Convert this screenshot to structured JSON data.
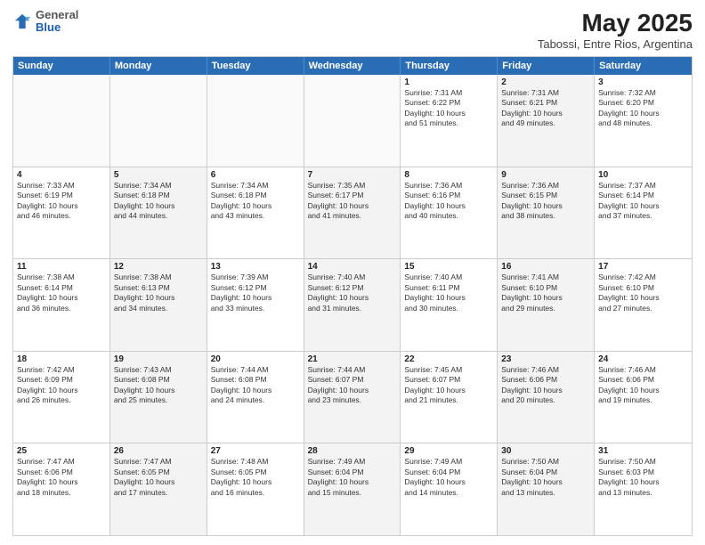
{
  "logo": {
    "general": "General",
    "blue": "Blue"
  },
  "title": "May 2025",
  "subtitle": "Tabossi, Entre Rios, Argentina",
  "weekdays": [
    "Sunday",
    "Monday",
    "Tuesday",
    "Wednesday",
    "Thursday",
    "Friday",
    "Saturday"
  ],
  "rows": [
    [
      {
        "day": "",
        "info": "",
        "empty": true
      },
      {
        "day": "",
        "info": "",
        "empty": true
      },
      {
        "day": "",
        "info": "",
        "empty": true
      },
      {
        "day": "",
        "info": "",
        "empty": true
      },
      {
        "day": "1",
        "info": "Sunrise: 7:31 AM\nSunset: 6:22 PM\nDaylight: 10 hours\nand 51 minutes."
      },
      {
        "day": "2",
        "info": "Sunrise: 7:31 AM\nSunset: 6:21 PM\nDaylight: 10 hours\nand 49 minutes.",
        "alt": true
      },
      {
        "day": "3",
        "info": "Sunrise: 7:32 AM\nSunset: 6:20 PM\nDaylight: 10 hours\nand 48 minutes."
      }
    ],
    [
      {
        "day": "4",
        "info": "Sunrise: 7:33 AM\nSunset: 6:19 PM\nDaylight: 10 hours\nand 46 minutes."
      },
      {
        "day": "5",
        "info": "Sunrise: 7:34 AM\nSunset: 6:18 PM\nDaylight: 10 hours\nand 44 minutes.",
        "alt": true
      },
      {
        "day": "6",
        "info": "Sunrise: 7:34 AM\nSunset: 6:18 PM\nDaylight: 10 hours\nand 43 minutes."
      },
      {
        "day": "7",
        "info": "Sunrise: 7:35 AM\nSunset: 6:17 PM\nDaylight: 10 hours\nand 41 minutes.",
        "alt": true
      },
      {
        "day": "8",
        "info": "Sunrise: 7:36 AM\nSunset: 6:16 PM\nDaylight: 10 hours\nand 40 minutes."
      },
      {
        "day": "9",
        "info": "Sunrise: 7:36 AM\nSunset: 6:15 PM\nDaylight: 10 hours\nand 38 minutes.",
        "alt": true
      },
      {
        "day": "10",
        "info": "Sunrise: 7:37 AM\nSunset: 6:14 PM\nDaylight: 10 hours\nand 37 minutes."
      }
    ],
    [
      {
        "day": "11",
        "info": "Sunrise: 7:38 AM\nSunset: 6:14 PM\nDaylight: 10 hours\nand 36 minutes."
      },
      {
        "day": "12",
        "info": "Sunrise: 7:38 AM\nSunset: 6:13 PM\nDaylight: 10 hours\nand 34 minutes.",
        "alt": true
      },
      {
        "day": "13",
        "info": "Sunrise: 7:39 AM\nSunset: 6:12 PM\nDaylight: 10 hours\nand 33 minutes."
      },
      {
        "day": "14",
        "info": "Sunrise: 7:40 AM\nSunset: 6:12 PM\nDaylight: 10 hours\nand 31 minutes.",
        "alt": true
      },
      {
        "day": "15",
        "info": "Sunrise: 7:40 AM\nSunset: 6:11 PM\nDaylight: 10 hours\nand 30 minutes."
      },
      {
        "day": "16",
        "info": "Sunrise: 7:41 AM\nSunset: 6:10 PM\nDaylight: 10 hours\nand 29 minutes.",
        "alt": true
      },
      {
        "day": "17",
        "info": "Sunrise: 7:42 AM\nSunset: 6:10 PM\nDaylight: 10 hours\nand 27 minutes."
      }
    ],
    [
      {
        "day": "18",
        "info": "Sunrise: 7:42 AM\nSunset: 6:09 PM\nDaylight: 10 hours\nand 26 minutes."
      },
      {
        "day": "19",
        "info": "Sunrise: 7:43 AM\nSunset: 6:08 PM\nDaylight: 10 hours\nand 25 minutes.",
        "alt": true
      },
      {
        "day": "20",
        "info": "Sunrise: 7:44 AM\nSunset: 6:08 PM\nDaylight: 10 hours\nand 24 minutes."
      },
      {
        "day": "21",
        "info": "Sunrise: 7:44 AM\nSunset: 6:07 PM\nDaylight: 10 hours\nand 23 minutes.",
        "alt": true
      },
      {
        "day": "22",
        "info": "Sunrise: 7:45 AM\nSunset: 6:07 PM\nDaylight: 10 hours\nand 21 minutes."
      },
      {
        "day": "23",
        "info": "Sunrise: 7:46 AM\nSunset: 6:06 PM\nDaylight: 10 hours\nand 20 minutes.",
        "alt": true
      },
      {
        "day": "24",
        "info": "Sunrise: 7:46 AM\nSunset: 6:06 PM\nDaylight: 10 hours\nand 19 minutes."
      }
    ],
    [
      {
        "day": "25",
        "info": "Sunrise: 7:47 AM\nSunset: 6:06 PM\nDaylight: 10 hours\nand 18 minutes."
      },
      {
        "day": "26",
        "info": "Sunrise: 7:47 AM\nSunset: 6:05 PM\nDaylight: 10 hours\nand 17 minutes.",
        "alt": true
      },
      {
        "day": "27",
        "info": "Sunrise: 7:48 AM\nSunset: 6:05 PM\nDaylight: 10 hours\nand 16 minutes."
      },
      {
        "day": "28",
        "info": "Sunrise: 7:49 AM\nSunset: 6:04 PM\nDaylight: 10 hours\nand 15 minutes.",
        "alt": true
      },
      {
        "day": "29",
        "info": "Sunrise: 7:49 AM\nSunset: 6:04 PM\nDaylight: 10 hours\nand 14 minutes."
      },
      {
        "day": "30",
        "info": "Sunrise: 7:50 AM\nSunset: 6:04 PM\nDaylight: 10 hours\nand 13 minutes.",
        "alt": true
      },
      {
        "day": "31",
        "info": "Sunrise: 7:50 AM\nSunset: 6:03 PM\nDaylight: 10 hours\nand 13 minutes."
      }
    ]
  ]
}
